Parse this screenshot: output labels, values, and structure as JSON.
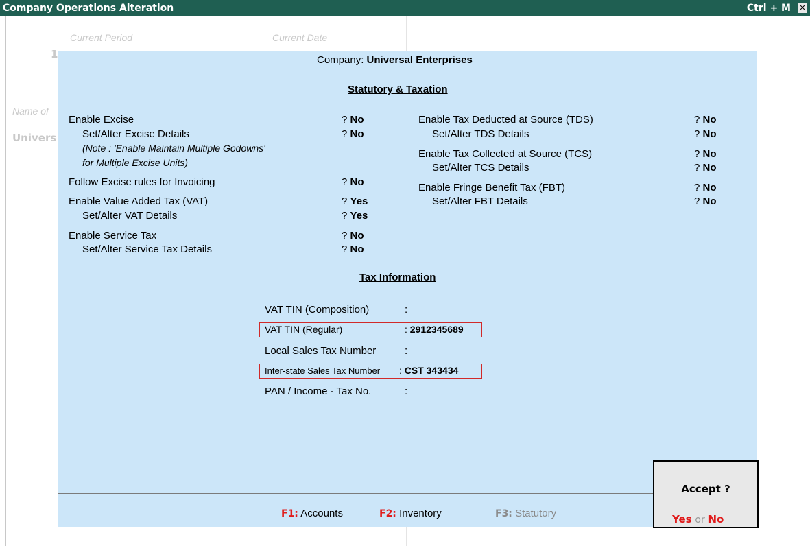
{
  "window": {
    "title": "Company Operations  Alteration",
    "shortcut": "Ctrl + M",
    "close_glyph": "✕"
  },
  "background": {
    "current_period": "Current Period",
    "current_date": "Current Date",
    "date_fragment": "1",
    "name_of": "Name of",
    "company_fragment": "Univers"
  },
  "company": {
    "label": "Company:",
    "name": "Universal Enterprises"
  },
  "statutory": {
    "heading": "Statutory & Taxation",
    "left": [
      {
        "label": "Enable Excise",
        "q": "?",
        "value": "No"
      },
      {
        "label": "Set/Alter Excise Details",
        "q": "?",
        "value": "No"
      },
      {
        "label": "Follow Excise rules for Invoicing",
        "q": "?",
        "value": "No"
      },
      {
        "label": "Enable Value Added Tax (VAT)",
        "q": "?",
        "value": "Yes"
      },
      {
        "label": "Set/Alter VAT Details",
        "q": "?",
        "value": "Yes"
      },
      {
        "label": "Enable Service Tax",
        "q": "?",
        "value": "No"
      },
      {
        "label": "Set/Alter Service Tax Details",
        "q": "?",
        "value": "No"
      }
    ],
    "note_line1": "(Note : 'Enable Maintain Multiple Godowns'",
    "note_line2": "for Multiple Excise Units)",
    "right": [
      {
        "label": "Enable Tax Deducted at Source (TDS)",
        "q": "?",
        "value": "No"
      },
      {
        "label": "Set/Alter TDS Details",
        "q": "?",
        "value": "No"
      },
      {
        "label": "Enable Tax Collected at Source (TCS)",
        "q": "?",
        "value": "No"
      },
      {
        "label": "Set/Alter TCS Details",
        "q": "?",
        "value": "No"
      },
      {
        "label": "Enable Fringe Benefit Tax (FBT)",
        "q": "?",
        "value": "No"
      },
      {
        "label": "Set/Alter FBT Details",
        "q": "?",
        "value": "No"
      }
    ]
  },
  "tax_info": {
    "heading": "Tax Information",
    "fields": [
      {
        "label": "VAT TIN (Composition)",
        "sep": ":",
        "value": ""
      },
      {
        "label": "VAT TIN (Regular)",
        "sep": ":",
        "value": "2912345689"
      },
      {
        "label": "Local Sales Tax Number",
        "sep": ":",
        "value": ""
      },
      {
        "label": "Inter-state Sales Tax Number",
        "sep": ":",
        "value": "CST 343434"
      },
      {
        "label": "PAN / Income - Tax No.",
        "sep": ":",
        "value": ""
      }
    ]
  },
  "footer": [
    {
      "key": "F1:",
      "label": "Accounts"
    },
    {
      "key": "F2:",
      "label": "Inventory"
    },
    {
      "key": "F3:",
      "label": "Statutory"
    }
  ],
  "accept": {
    "question": "Accept ?",
    "yes": "Yes",
    "or": "or",
    "no": "No"
  },
  "colors": {
    "title_bar": "#1f5f52",
    "panel": "#cce6f9",
    "highlight": "#d12a2a",
    "key": "#e01b1b"
  }
}
